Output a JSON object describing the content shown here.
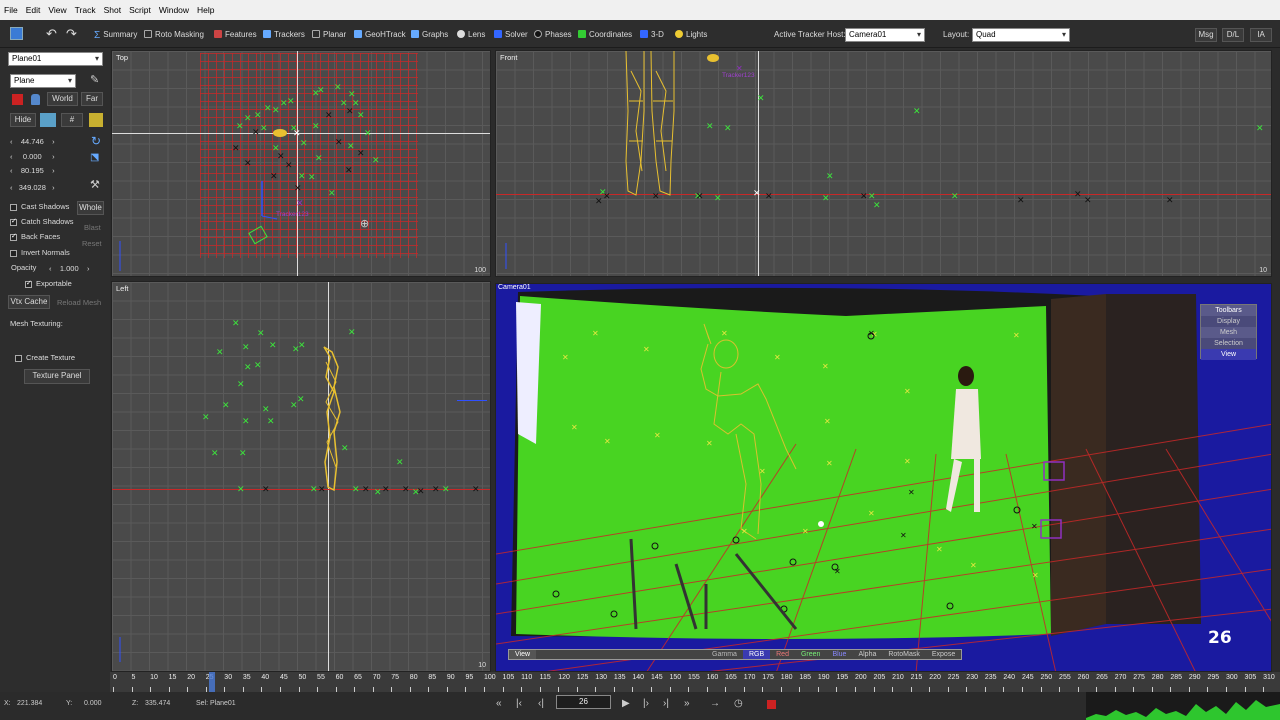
{
  "menu": [
    "File",
    "Edit",
    "View",
    "Track",
    "Shot",
    "Script",
    "Window",
    "Help"
  ],
  "toolbar": {
    "tools": [
      "Summary",
      "Roto Masking",
      "Features",
      "Trackers",
      "Planar",
      "GeoHTrack",
      "Graphs",
      "Lens",
      "Solver",
      "Phases",
      "Coordinates",
      "3-D",
      "Lights"
    ],
    "active_tracker_host_label": "Active Tracker Host:",
    "active_tracker_host_value": "Camera01",
    "layout_label": "Layout:",
    "layout_value": "Quad",
    "msg": "Msg",
    "dl": "D/L",
    "ia": "IA"
  },
  "left_panel": {
    "object_select": "Plane01",
    "type_select": "Plane",
    "world": "World",
    "far": "Far",
    "hide": "Hide",
    "hash": "#",
    "values": [
      "44.746",
      "0.000",
      "80.195",
      "349.028"
    ],
    "cast_shadows": "Cast Shadows",
    "whole": "Whole",
    "catch_shadows": "Catch Shadows",
    "blast": "Blast",
    "back_faces": "Back Faces",
    "reset": "Reset",
    "invert_normals": "Invert Normals",
    "opacity_label": "Opacity",
    "opacity_value": "1.000",
    "exportable": "Exportable",
    "vtx_cache": "Vtx Cache",
    "reload_mesh": "Reload Mesh",
    "mesh_texturing": "Mesh Texturing:",
    "create_texture": "Create Texture",
    "texture_panel": "Texture Panel"
  },
  "viewports": {
    "top": {
      "label": "Top",
      "scale": "100",
      "tracker": "Tracker123"
    },
    "front": {
      "label": "Front",
      "scale": "10",
      "tracker": "Tracker123"
    },
    "left": {
      "label": "Left",
      "scale": "10"
    },
    "camera": {
      "label": "Camera01",
      "side_menu": [
        "Toolbars",
        "Display",
        "Mesh",
        "Selection",
        "View"
      ],
      "bottom_tabs": [
        "View",
        "Gamma",
        "RGB",
        "Red",
        "Green",
        "Blue",
        "Alpha",
        "RotoMask",
        "Expose"
      ],
      "frame_number": "26"
    }
  },
  "timeline": {
    "ticks": [
      "0",
      "5",
      "10",
      "15",
      "20",
      "25",
      "30",
      "35",
      "40",
      "45",
      "50",
      "55",
      "60",
      "65",
      "70",
      "75",
      "80",
      "85",
      "90",
      "95",
      "100",
      "105",
      "110",
      "115",
      "120",
      "125",
      "130",
      "135",
      "140",
      "145",
      "150",
      "155",
      "160",
      "165",
      "170",
      "175",
      "180",
      "185",
      "190",
      "195",
      "200",
      "205",
      "210",
      "215",
      "220",
      "225",
      "230",
      "235",
      "240",
      "245",
      "250",
      "255",
      "260",
      "265",
      "270",
      "275",
      "280",
      "285",
      "290",
      "295",
      "300",
      "305",
      "310"
    ],
    "current_frame": 26
  },
  "status": {
    "x_label": "X:",
    "x_value": "221.384",
    "y_label": "Y:",
    "y_value": "0.000",
    "z_label": "Z:",
    "z_value": "335.474",
    "sel": "Sel: Plane01"
  },
  "colors": {
    "accent": "#3ce63c",
    "track_red": "#c82828",
    "cam_bg": "#1a1aa0",
    "figure": "#e8c030"
  }
}
